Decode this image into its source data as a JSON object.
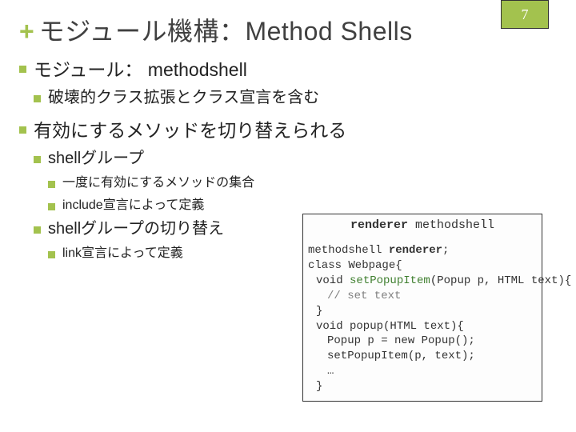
{
  "page_number": "7",
  "title": "モジュール機構：Method Shells",
  "b1": {
    "pre": "モジュール",
    "post": "： methodshell"
  },
  "b1_1": "破壊的クラス拡張とクラス宣言を含む",
  "b2": "有効にするメソッドを切り替えられる",
  "b2_1": {
    "pre": "shell",
    "post": "グループ"
  },
  "b2_1_1": "一度に有効にするメソッドの集合",
  "b2_1_2": {
    "pre": "include",
    "post": "宣言によって定義"
  },
  "b2_2": {
    "pre": "shell",
    "post": "グループの切り替え"
  },
  "b2_2_1": {
    "pre": "link",
    "post": "宣言によって定義"
  },
  "code": {
    "title_kw": "renderer",
    "title_rest": " methodshell",
    "l1a": "methodshell ",
    "l1b": "renderer",
    "l1c": ";",
    "l2": "class Webpage{",
    "l3a": "void ",
    "l3b": "setPopupItem",
    "l3c": "(Popup p, HTML text){",
    "l4": "// set text",
    "l5": "}",
    "l6": "void popup(HTML text){",
    "l7": "Popup p = new Popup();",
    "l8": "setPopupItem(p, text);",
    "l9": "…",
    "l10": "}"
  }
}
